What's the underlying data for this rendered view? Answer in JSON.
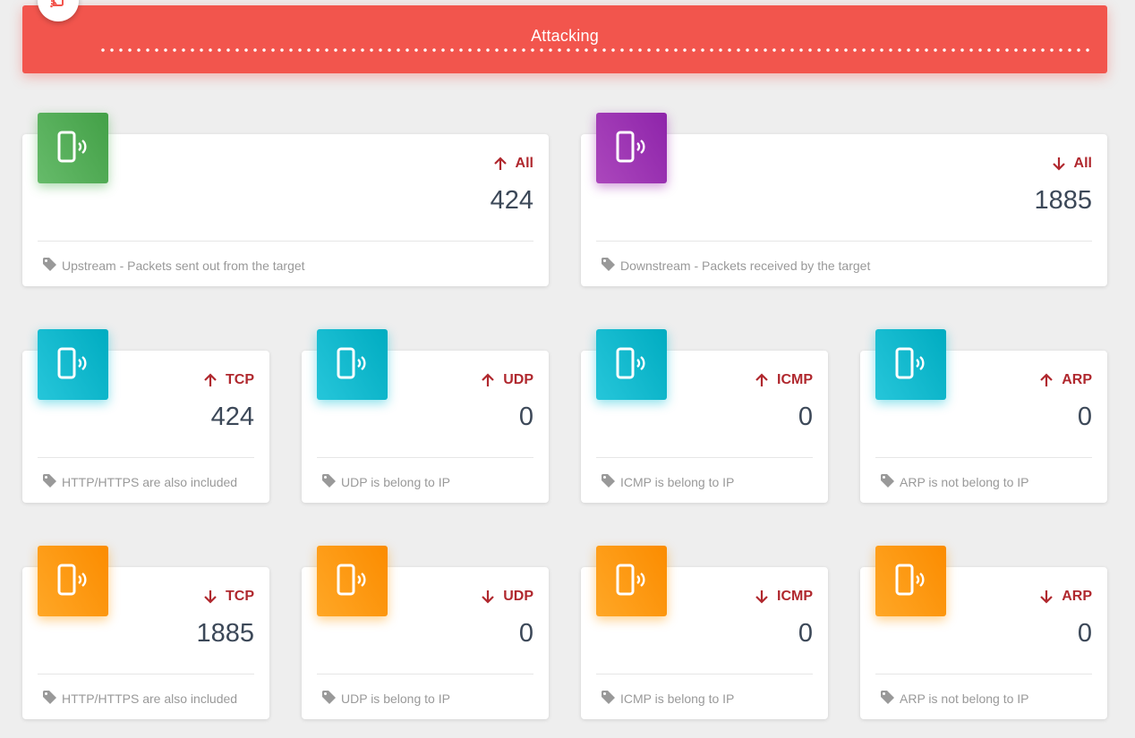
{
  "banner": {
    "title": "Attacking",
    "color": "#f2554d",
    "icon": "phone-wireless-icon"
  },
  "summary": [
    {
      "direction": "up",
      "protocol": "All",
      "value": "424",
      "description": "Upstream - Packets sent out from the target",
      "color": "#4caf50"
    },
    {
      "direction": "down",
      "protocol": "All",
      "value": "1885",
      "description": "Downstream - Packets received by the target",
      "color": "#9c27b0"
    }
  ],
  "upstream": [
    {
      "direction": "up",
      "protocol": "TCP",
      "value": "424",
      "description": "HTTP/HTTPS are also included",
      "color": "#00bcd4"
    },
    {
      "direction": "up",
      "protocol": "UDP",
      "value": "0",
      "description": "UDP is belong to IP",
      "color": "#00bcd4"
    },
    {
      "direction": "up",
      "protocol": "ICMP",
      "value": "0",
      "description": "ICMP is belong to IP",
      "color": "#00bcd4"
    },
    {
      "direction": "up",
      "protocol": "ARP",
      "value": "0",
      "description": "ARP is not belong to IP",
      "color": "#00bcd4"
    }
  ],
  "downstream": [
    {
      "direction": "down",
      "protocol": "TCP",
      "value": "1885",
      "description": "HTTP/HTTPS are also included",
      "color": "#ff9800"
    },
    {
      "direction": "down",
      "protocol": "UDP",
      "value": "0",
      "description": "UDP is belong to IP",
      "color": "#ff9800"
    },
    {
      "direction": "down",
      "protocol": "ICMP",
      "value": "0",
      "description": "ICMP is belong to IP",
      "color": "#ff9800"
    },
    {
      "direction": "down",
      "protocol": "ARP",
      "value": "0",
      "description": "ARP is not belong to IP",
      "color": "#ff9800"
    }
  ],
  "icons": {
    "card": "phone-wireless-icon",
    "footer": "tag-icon",
    "up": "arrow-up-icon",
    "down": "arrow-down-icon"
  },
  "colors": {
    "label": "#b0282e",
    "value": "#3c4858",
    "footer": "#999999"
  }
}
